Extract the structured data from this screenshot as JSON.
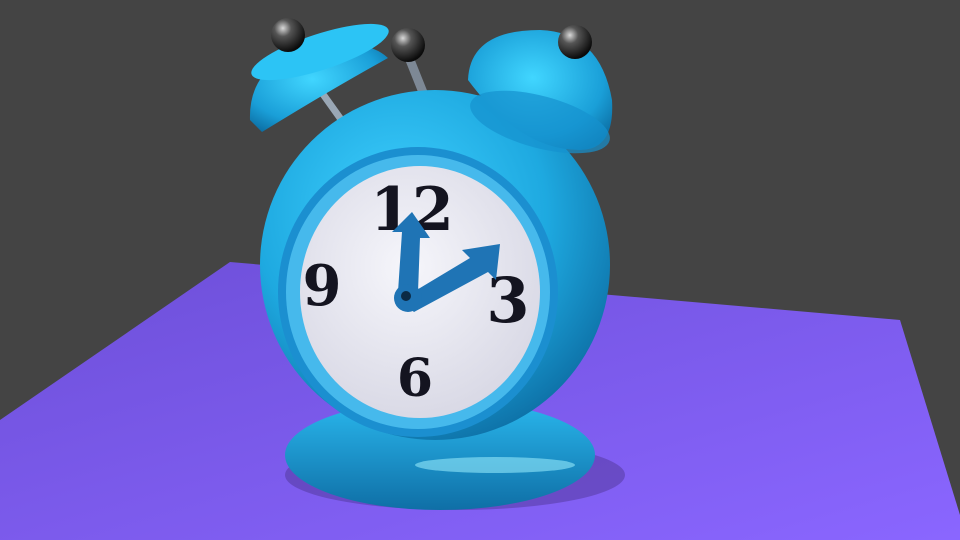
{
  "scene": {
    "background_color": "#444444",
    "floor_color": "#7d5fe6",
    "clock_body_color": "#1fb3e8",
    "clock_dark_color": "#0f7fb5",
    "dial_color": "#e9e9f1",
    "numeral_color": "#141420",
    "hand_color": "#1f74b5"
  },
  "clock": {
    "numerals": {
      "n12": "12",
      "n3": "3",
      "n6": "6",
      "n9": "9"
    },
    "time_shown": {
      "hour_hand_points_toward": "12",
      "minute_hand_points_toward": "2"
    }
  }
}
